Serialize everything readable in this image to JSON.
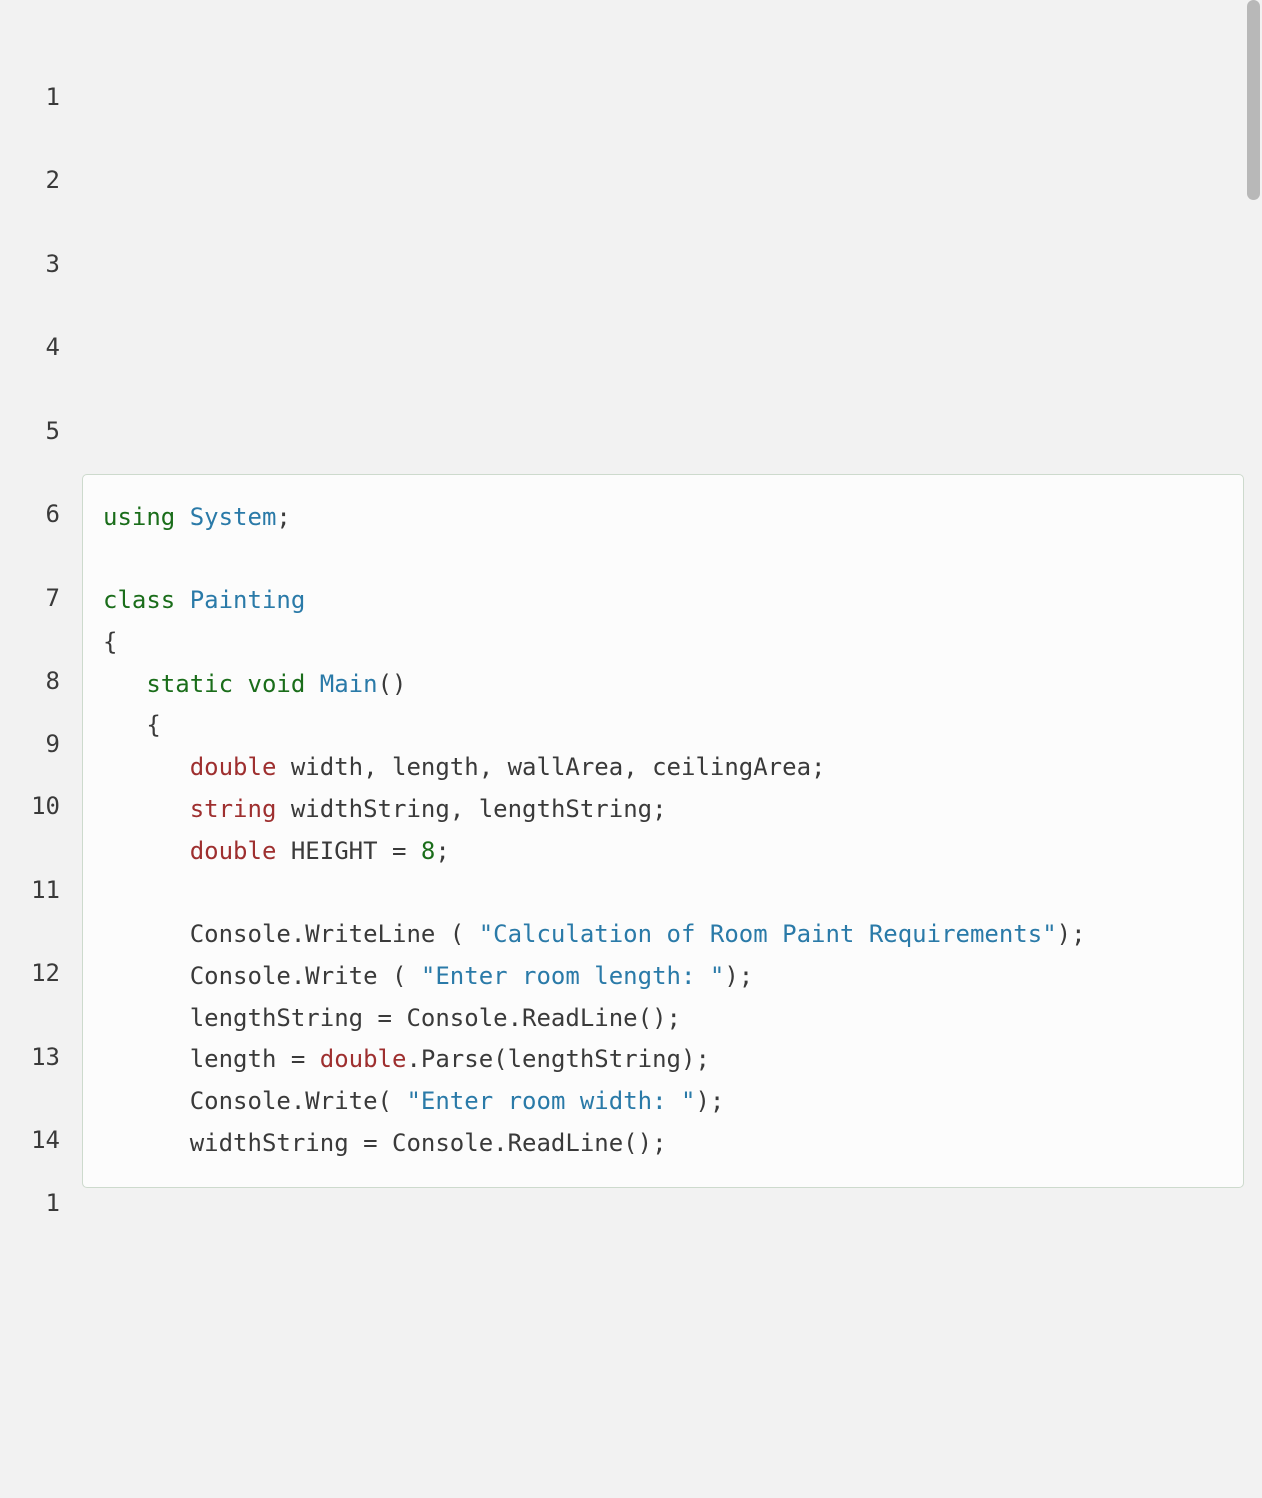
{
  "lineNumbers": [
    "1",
    "2",
    "3",
    "4",
    "5",
    "6",
    "7",
    "8",
    "9",
    "10",
    "11",
    "12",
    "13",
    "14",
    "1"
  ],
  "code": {
    "tokens": [
      {
        "t": "keyword",
        "v": "using"
      },
      {
        "t": "space",
        "v": " "
      },
      {
        "t": "type",
        "v": "System"
      },
      {
        "t": "punc",
        "v": ";"
      },
      {
        "t": "nl"
      },
      {
        "t": "nl"
      },
      {
        "t": "keyword",
        "v": "class"
      },
      {
        "t": "space",
        "v": " "
      },
      {
        "t": "type",
        "v": "Painting"
      },
      {
        "t": "nl"
      },
      {
        "t": "punc",
        "v": "{"
      },
      {
        "t": "nl"
      },
      {
        "t": "space",
        "v": "   "
      },
      {
        "t": "keyword",
        "v": "static"
      },
      {
        "t": "space",
        "v": " "
      },
      {
        "t": "keyword",
        "v": "void"
      },
      {
        "t": "space",
        "v": " "
      },
      {
        "t": "method",
        "v": "Main"
      },
      {
        "t": "punc",
        "v": "()"
      },
      {
        "t": "nl"
      },
      {
        "t": "space",
        "v": "   "
      },
      {
        "t": "punc",
        "v": "{"
      },
      {
        "t": "nl"
      },
      {
        "t": "space",
        "v": "      "
      },
      {
        "t": "decl",
        "v": "double"
      },
      {
        "t": "space",
        "v": " "
      },
      {
        "t": "ident",
        "v": "width, length, wallArea, ceilingArea;"
      },
      {
        "t": "nl"
      },
      {
        "t": "space",
        "v": "      "
      },
      {
        "t": "decl",
        "v": "string"
      },
      {
        "t": "space",
        "v": " "
      },
      {
        "t": "ident",
        "v": "widthString, lengthString;"
      },
      {
        "t": "nl"
      },
      {
        "t": "space",
        "v": "      "
      },
      {
        "t": "decl",
        "v": "double"
      },
      {
        "t": "space",
        "v": " "
      },
      {
        "t": "ident",
        "v": "HEIGHT = "
      },
      {
        "t": "number",
        "v": "8"
      },
      {
        "t": "punc",
        "v": ";"
      },
      {
        "t": "nl"
      },
      {
        "t": "nl"
      },
      {
        "t": "space",
        "v": "      "
      },
      {
        "t": "ident",
        "v": "Console.WriteLine ( "
      },
      {
        "t": "string",
        "v": "\"Calculation of Room Paint Requirements\""
      },
      {
        "t": "punc",
        "v": ");"
      },
      {
        "t": "nl"
      },
      {
        "t": "space",
        "v": "      "
      },
      {
        "t": "ident",
        "v": "Console.Write ( "
      },
      {
        "t": "string",
        "v": "\"Enter room length: \""
      },
      {
        "t": "punc",
        "v": ");"
      },
      {
        "t": "nl"
      },
      {
        "t": "space",
        "v": "      "
      },
      {
        "t": "ident",
        "v": "lengthString = Console.ReadLine();"
      },
      {
        "t": "nl"
      },
      {
        "t": "space",
        "v": "      "
      },
      {
        "t": "ident",
        "v": "length = "
      },
      {
        "t": "decl",
        "v": "double"
      },
      {
        "t": "ident",
        "v": ".Parse(lengthString);"
      },
      {
        "t": "nl"
      },
      {
        "t": "space",
        "v": "      "
      },
      {
        "t": "ident",
        "v": "Console.Write( "
      },
      {
        "t": "string",
        "v": "\"Enter room width: \""
      },
      {
        "t": "punc",
        "v": ");"
      },
      {
        "t": "nl"
      },
      {
        "t": "space",
        "v": "      "
      },
      {
        "t": "ident",
        "v": "widthString = Console.ReadLine();"
      },
      {
        "t": "nl"
      }
    ]
  }
}
